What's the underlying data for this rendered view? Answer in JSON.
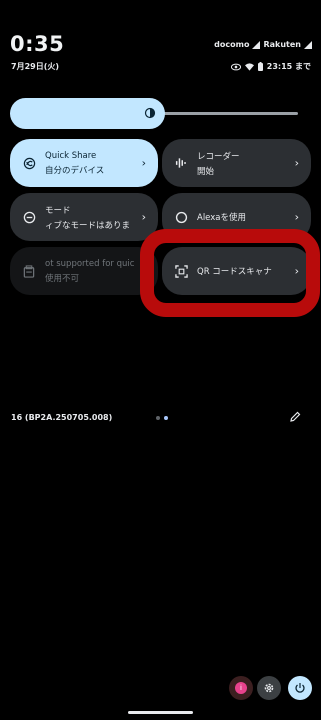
{
  "status_bar": {
    "time": "0:35",
    "date": "7月29日(火)",
    "carrier_1": "docomo",
    "carrier_2": "Rakuten",
    "alarm_text": "23:15 まで"
  },
  "brightness": {
    "level": 0.5,
    "icon": "brightness-icon"
  },
  "tiles": [
    {
      "id": "quick-share",
      "title": "Quick Share",
      "subtitle": "自分のデバイス",
      "icon": "quick-share-icon",
      "active": true
    },
    {
      "id": "recorder",
      "title": "レコーダー",
      "subtitle": "開始",
      "icon": "waveform-icon",
      "active": false
    },
    {
      "id": "mode",
      "title": "モード",
      "subtitle": "ィブなモードはありま",
      "icon": "minus-circle-icon",
      "active": false
    },
    {
      "id": "alexa",
      "title": "Alexaを使用",
      "subtitle": "",
      "icon": "alexa-icon",
      "active": false
    },
    {
      "id": "unsupported",
      "title": "ot supported for quic",
      "subtitle": "使用不可",
      "icon": "wallet-icon",
      "active": false
    },
    {
      "id": "qr-scanner",
      "title": "QR コードスキャナ",
      "subtitle": "",
      "icon": "qr-scan-icon",
      "active": false
    }
  ],
  "footer": {
    "build_number": "16 (BP2A.250705.008)",
    "page_index": 1,
    "page_count": 2
  },
  "colors": {
    "accent": "#c2e7ff",
    "highlight": "#b80b0b",
    "tile": "#2c2f33"
  }
}
